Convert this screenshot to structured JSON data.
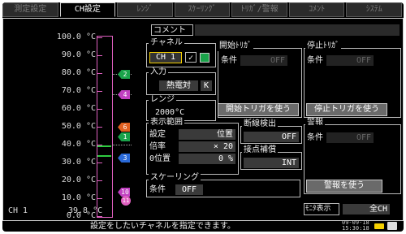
{
  "tabs": [
    {
      "label": "測定設定",
      "active": false
    },
    {
      "label": "CH設定",
      "active": true
    },
    {
      "label": "ﾚﾝｼﾞ",
      "active": false
    },
    {
      "label": "ｽｹｰﾘﾝｸﾞ",
      "active": false
    },
    {
      "label": "ﾄﾘｶﾞ/警報",
      "active": false
    },
    {
      "label": "ｺﾒﾝﾄ",
      "active": false
    },
    {
      "label": "ｼｽﾃﾑ",
      "active": false
    }
  ],
  "scale_labels": [
    "100.0 °C",
    "90.0 °C",
    "80.0 °C",
    "70.0 °C",
    "60.0 °C",
    "50.0 °C",
    "40.0 °C",
    "30.0 °C",
    "20.0 °C",
    "10.0 °C",
    "0.0 °C"
  ],
  "markers": {
    "m2": "2",
    "m4": "4",
    "m6": "6",
    "m1": "1",
    "m3": "3",
    "m10": "10",
    "m11": "11"
  },
  "current_channel": {
    "label": "CH 1",
    "value": "39.8 °C"
  },
  "comment": {
    "label": "コメント",
    "value": ""
  },
  "channel": {
    "title": "チャネル",
    "value": "CH 1",
    "check": "✓"
  },
  "input": {
    "title": "入力",
    "type": "熱電対",
    "subtype": "K"
  },
  "range": {
    "title": "レンジ",
    "value": "2000°C"
  },
  "start_trigger": {
    "title": "開始ﾄﾘｶﾞ",
    "cond_label": "条件",
    "cond_value": "OFF",
    "button": "開始トリガを使う"
  },
  "stop_trigger": {
    "title": "停止ﾄﾘｶﾞ",
    "cond_label": "条件",
    "cond_value": "OFF",
    "button": "停止トリガを使う"
  },
  "display_range": {
    "title": "表示範囲",
    "setting_label": "設定",
    "setting_value": "位置",
    "mag_label": "倍率",
    "mag_value": "× 20",
    "zero_label": "0位置",
    "zero_value": "0 %"
  },
  "burnout": {
    "title": "断線検出",
    "value": "OFF"
  },
  "rjc": {
    "title": "接点補償",
    "value": "INT"
  },
  "alarm": {
    "title": "警報",
    "cond_label": "条件",
    "cond_value": "OFF",
    "button": "警報を使う"
  },
  "scaling": {
    "title": "スケーリング",
    "cond_label": "条件",
    "cond_value": "OFF"
  },
  "monitor": {
    "label": "ﾓﾆﾀ表示",
    "value": "全CH"
  },
  "status": {
    "message": "設定をしたいチャネルを指定できます。",
    "date": "09-09-18",
    "time": "15:30:18"
  }
}
